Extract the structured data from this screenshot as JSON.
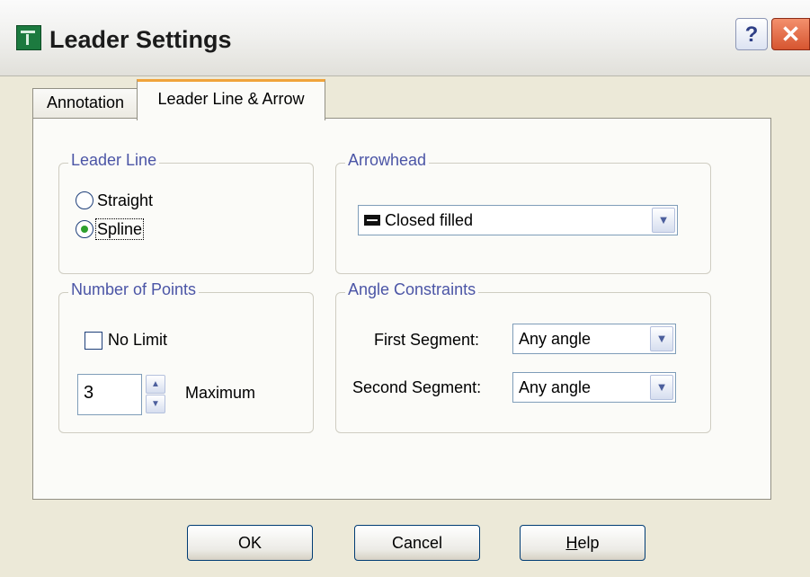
{
  "window": {
    "title": "Leader Settings",
    "help_button": "?",
    "close_button": "✕"
  },
  "tabs": [
    {
      "label": "Annotation",
      "active": false
    },
    {
      "label": "Leader Line & Arrow",
      "active": true
    }
  ],
  "leader_line": {
    "group_label": "Leader Line",
    "options": [
      {
        "label": "Straight",
        "checked": false
      },
      {
        "label": "Spline",
        "checked": true
      }
    ]
  },
  "arrowhead": {
    "group_label": "Arrowhead",
    "selected": "Closed filled"
  },
  "number_of_points": {
    "group_label": "Number of Points",
    "no_limit_label": "No Limit",
    "no_limit_checked": false,
    "maximum_value": "3",
    "maximum_label": "Maximum"
  },
  "angle_constraints": {
    "group_label": "Angle Constraints",
    "first_segment_label": "First Segment:",
    "first_segment_value": "Any angle",
    "second_segment_label": "Second Segment:",
    "second_segment_value": "Any angle"
  },
  "buttons": {
    "ok": "OK",
    "cancel": "Cancel",
    "help": "Help"
  },
  "colors": {
    "group_label": "#4b55a6",
    "active_tab_accent": "#f0a43b",
    "close_button": "#d65530"
  }
}
